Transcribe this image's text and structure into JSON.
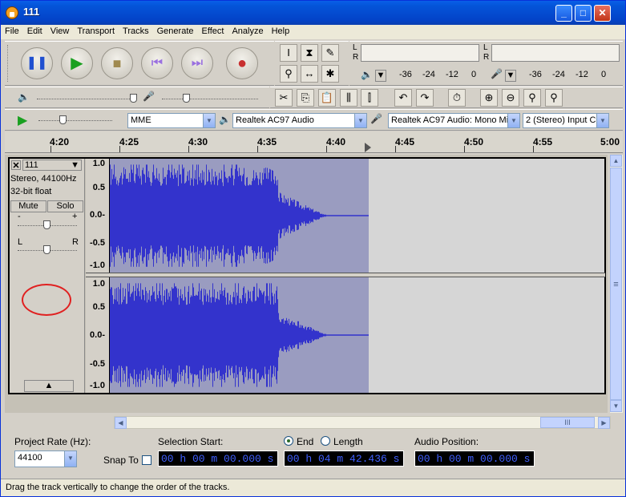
{
  "window": {
    "title": "111"
  },
  "menu": [
    "File",
    "Edit",
    "View",
    "Transport",
    "Tracks",
    "Generate",
    "Effect",
    "Analyze",
    "Help"
  ],
  "meters": {
    "play_scale": [
      "-36",
      "-24",
      "-12",
      "0"
    ],
    "rec_scale": [
      "-36",
      "-24",
      "-12",
      "0"
    ],
    "lr_top": "L",
    "lr_bottom": "R"
  },
  "devices": {
    "host": "MME",
    "output": "Realtek AC97 Audio",
    "input": "Realtek AC97 Audio: Mono Mix",
    "channels": "2 (Stereo) Input C"
  },
  "ruler": {
    "labels": [
      "4:20",
      "4:25",
      "4:30",
      "4:35",
      "4:40",
      "4:45",
      "4:50",
      "4:55",
      "5:00"
    ]
  },
  "track": {
    "name": "111",
    "info1": "Stereo, 44100Hz",
    "info2": "32-bit float",
    "mute": "Mute",
    "solo": "Solo",
    "gain_minus": "-",
    "gain_plus": "+",
    "pan_left": "L",
    "pan_right": "R",
    "scale": [
      "1.0",
      "0.5",
      "0.0-",
      "-0.5",
      "-1.0"
    ]
  },
  "bottom": {
    "rate_label": "Project Rate (Hz):",
    "rate_value": "44100",
    "snap_label": "Snap To",
    "sel_start_label": "Selection Start:",
    "end_label": "End",
    "length_label": "Length",
    "sel_start": "00 h 00 m 00.000 s",
    "sel_end": "00 h 04 m 42.436 s",
    "audio_pos_label": "Audio Position:",
    "audio_pos": "00 h 00 m 00.000 s"
  },
  "status": "Drag the track vertically to change the order of the tracks.",
  "colors": {
    "wave": "#3333cc",
    "wave_bg": "#9a9cc0",
    "timecode": "#4060ff"
  }
}
